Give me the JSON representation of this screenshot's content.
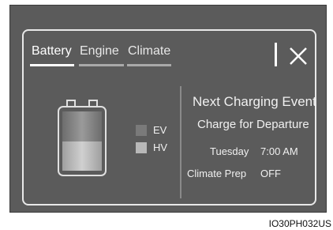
{
  "tabs": [
    {
      "label": "Battery",
      "active": true
    },
    {
      "label": "Engine",
      "active": false
    },
    {
      "label": "Climate",
      "active": false
    }
  ],
  "close_icon": "close-icon",
  "battery_icon": "battery-icon",
  "battery": {
    "ev_fraction": 0.35,
    "hv_fraction": 0.4
  },
  "legend": {
    "ev_label": "EV",
    "hv_label": "HV"
  },
  "charging": {
    "title": "Next Charging Event",
    "subtitle": "Charge for Departure",
    "day": "Tuesday",
    "time": "7:00 AM",
    "climate_prep_label": "Climate Prep",
    "climate_prep_value": "OFF"
  },
  "figure_code": "IO30PH032US",
  "colors": {
    "screen_bg": "#5b5b5b",
    "panel_border": "#e8e8e8",
    "text": "#f0f0f0",
    "inactive_tab_underline": "#a9a9a9",
    "ev_swatch": "#7a7a7a",
    "hv_swatch": "#b8b8b8"
  }
}
